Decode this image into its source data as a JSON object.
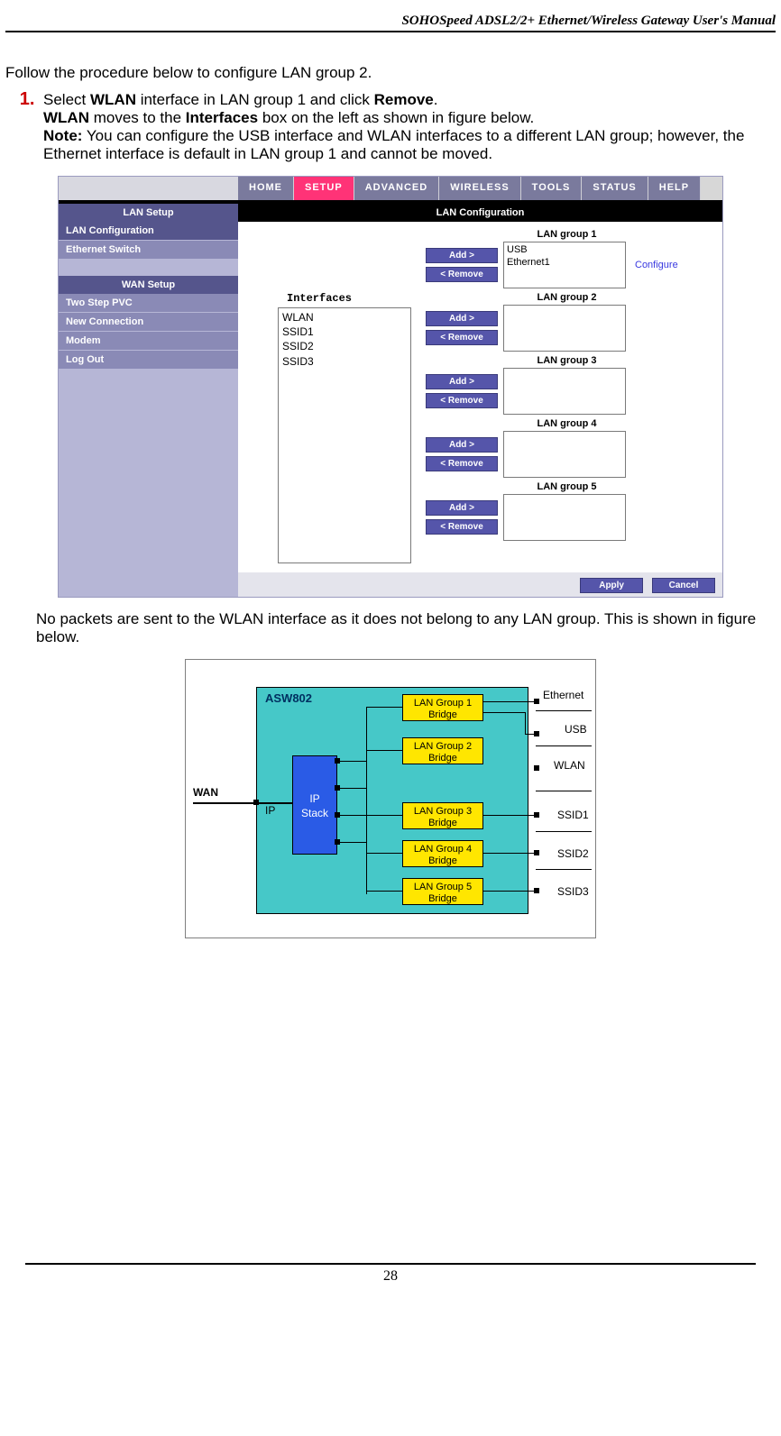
{
  "header": "SOHOSpeed ADSL2/2+ Ethernet/Wireless Gateway User's Manual",
  "intro": "Follow the procedure below to configure LAN group 2.",
  "step1": {
    "num": "1.",
    "line1a": "Select ",
    "wlan": "WLAN",
    "line1b": " interface in LAN group 1 and click ",
    "remove": "Remove",
    "line1c": ".",
    "line2a": "WLAN",
    "line2b": " moves to the ",
    "interfaces": "Interfaces",
    "line2c": " box on the left as shown in figure below.",
    "note_label": "Note:",
    "note": " You can configure the USB interface and WLAN interfaces to a different LAN group; however, the Ethernet interface is default in LAN group 1 and cannot be moved."
  },
  "fig1": {
    "nav": {
      "home": "HOME",
      "setup": "SETUP",
      "advanced": "ADVANCED",
      "wireless": "WIRELESS",
      "tools": "TOOLS",
      "status": "STATUS",
      "help": "HELP"
    },
    "side": {
      "lan_setup": "LAN Setup",
      "lan_config": "LAN Configuration",
      "eth_switch": "Ethernet Switch",
      "wan_setup": "WAN Setup",
      "two_step": "Two Step PVC",
      "new_conn": "New Connection",
      "modem": "Modem",
      "logout": "Log Out"
    },
    "title": "LAN Configuration",
    "interfaces_label": "Interfaces",
    "interfaces": {
      "a": "WLAN",
      "b": "SSID1",
      "c": "SSID2",
      "d": "SSID3"
    },
    "add": "Add >",
    "removebtn": "< Remove",
    "g1": "LAN group 1",
    "g2": "LAN group 2",
    "g3": "LAN group 3",
    "g4": "LAN group 4",
    "g5": "LAN group 5",
    "g1a": "USB",
    "g1b": "Ethernet1",
    "configure": "Configure",
    "apply": "Apply",
    "cancel": "Cancel"
  },
  "para2": "No packets are sent to the WLAN interface as it does not belong to any LAN group. This is shown in figure below.",
  "diagram": {
    "asw": "ASW802",
    "ip1": "IP",
    "ip2": "Stack",
    "b1": "LAN Group 1\nBridge",
    "b2": "LAN Group 2\nBridge",
    "b3": "LAN Group 3\nBridge",
    "b4": "LAN Group 4\nBridge",
    "b5": "LAN Group 5\nBridge",
    "wan": "WAN",
    "iplbl": "IP",
    "eth": "Ethernet",
    "usb": "USB",
    "wlan": "WLAN",
    "s1": "SSID1",
    "s2": "SSID2",
    "s3": "SSID3"
  },
  "pagenum": "28"
}
